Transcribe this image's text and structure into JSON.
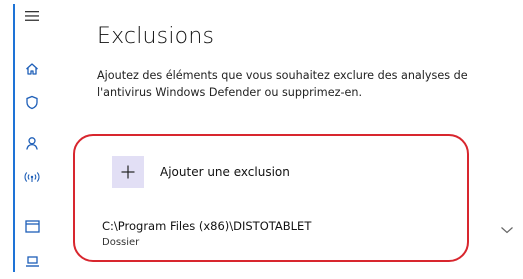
{
  "nav": {
    "items": [
      {
        "icon": "hamburger-menu-icon"
      },
      {
        "icon": "home-icon"
      },
      {
        "icon": "shield-icon"
      },
      {
        "icon": "person-icon"
      },
      {
        "icon": "wireless-icon"
      },
      {
        "icon": "app-browser-icon"
      },
      {
        "icon": "device-icon"
      }
    ],
    "accent_color": "#1e73d6"
  },
  "page": {
    "title": "Exclusions",
    "description": "Ajoutez des éléments que vous souhaitez exclure des analyses de l'antivirus Windows Defender ou supprimez-en."
  },
  "add_exclusion": {
    "label": "Ajouter une exclusion",
    "icon": "plus-icon"
  },
  "exclusions": [
    {
      "path": "C:\\Program Files (x86)\\DISTOTABLET",
      "type": "Dossier"
    }
  ],
  "highlight_color": "#d8262e"
}
